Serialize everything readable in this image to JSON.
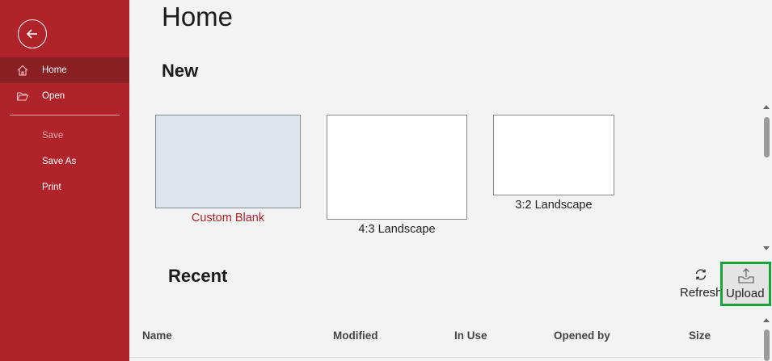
{
  "sidebar": {
    "back_icon": "back-arrow-icon",
    "items": [
      {
        "label": "Home",
        "icon": "home-icon",
        "active": true
      },
      {
        "label": "Open",
        "icon": "folder-open-icon"
      },
      {
        "label": "Save",
        "disabled": true
      },
      {
        "label": "Save As"
      },
      {
        "label": "Print"
      }
    ]
  },
  "main": {
    "title": "Home",
    "new_section": {
      "title": "New",
      "templates": [
        {
          "label": "Custom Blank"
        },
        {
          "label": "4:3 Landscape"
        },
        {
          "label": "3:2 Landscape"
        }
      ]
    },
    "recent_section": {
      "title": "Recent",
      "refresh_label": "Refresh",
      "upload_label": "Upload",
      "columns": [
        "Name",
        "Modified",
        "In Use",
        "Opened by",
        "Size"
      ]
    }
  },
  "colors": {
    "sidebar": "#b0232a",
    "sidebar_active": "#8a1f24",
    "highlight": "#1aa33c",
    "custom_blank_fill": "#dce4ee"
  }
}
